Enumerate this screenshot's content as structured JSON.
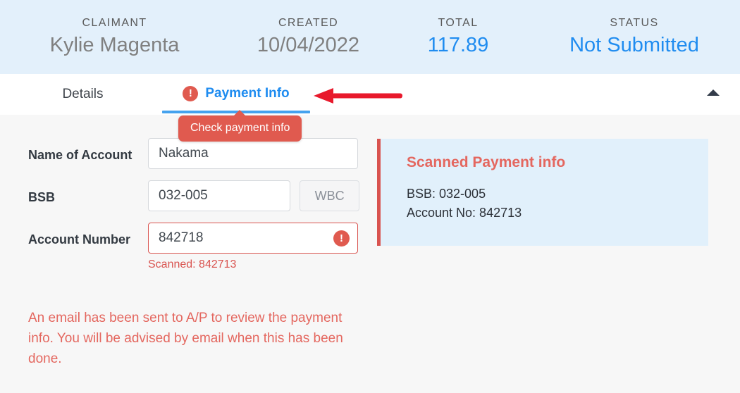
{
  "summary": {
    "cells": [
      {
        "label": "CLAIMANT",
        "value": "Kylie Magenta",
        "accent": false
      },
      {
        "label": "CREATED",
        "value": "10/04/2022",
        "accent": false
      },
      {
        "label": "TOTAL",
        "value": "117.89",
        "accent": true
      },
      {
        "label": "STATUS",
        "value": "Not Submitted",
        "accent": true
      }
    ]
  },
  "tabs": {
    "details_label": "Details",
    "payment_label": "Payment Info",
    "payment_error_icon": "error-exclamation-icon",
    "collapse_icon": "chevron-up-icon"
  },
  "tooltip": {
    "text": "Check payment info"
  },
  "annotation": {
    "arrow_icon": "left-arrow-annotation",
    "color": "#e8192c"
  },
  "form": {
    "name_label": "Name of Account",
    "name_value": "Nakama",
    "bsb_label": "BSB",
    "bsb_value": "032-005",
    "bank_chip": "WBC",
    "account_label": "Account Number",
    "account_value": "842718",
    "account_error_icon": "error-exclamation-icon",
    "scanned_note": "Scanned: 842713",
    "email_note": "An email has been sent to A/P to review the payment info. You will be advised by email when this has been done."
  },
  "scan_panel": {
    "title": "Scanned Payment info",
    "lines": [
      "BSB: 032-005",
      "Account No: 842713"
    ]
  },
  "colors": {
    "header_bg": "#e3f0fb",
    "accent_blue": "#1f8cf0",
    "error_red": "#d9534f",
    "tooltip_red": "#e05a4f",
    "page_bg": "#f7f7f7"
  }
}
